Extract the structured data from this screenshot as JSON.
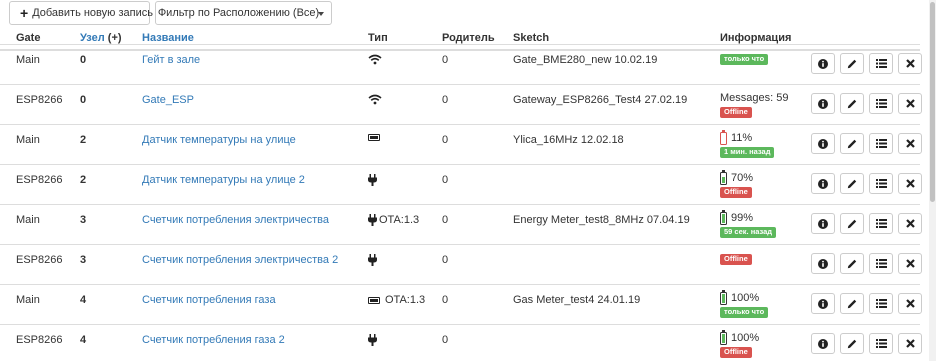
{
  "toolbar": {
    "add_label": "Добавить новую запись",
    "filter_label": "Фильтр по Расположению (Все)"
  },
  "columns": {
    "gate": "Gate",
    "node": "Узел",
    "node_sort": "(+)",
    "name": "Название",
    "type": "Тип",
    "parent": "Родитель",
    "sketch": "Sketch",
    "info": "Информация"
  },
  "colors": {
    "link": "#337ab7",
    "label_green": "#5cb85c",
    "label_red": "#d9534f"
  },
  "rows": [
    {
      "gate": "Main",
      "node": "0",
      "name": "Гейт в зале",
      "type_icon": "wifi-icon",
      "type_text": "",
      "parent": "0",
      "sketch": "Gate_BME280_new  10.02.19",
      "info_text": "",
      "battery": null,
      "status": "только что",
      "status_color": "green"
    },
    {
      "gate": "ESP8266",
      "node": "0",
      "name": "Gate_ESP",
      "type_icon": "wifi-icon",
      "type_text": "",
      "parent": "0",
      "sketch": "Gateway_ESP8266_Test4  27.02.19",
      "info_text": "Messages: 59",
      "battery": null,
      "status": "Offline",
      "status_color": "red"
    },
    {
      "gate": "Main",
      "node": "2",
      "name": "Датчик температуры на улице",
      "type_icon": "battery-icon",
      "type_text": "",
      "parent": "0",
      "sketch": "Ylica_16MHz  12.02.18",
      "info_text": "",
      "battery": "11%",
      "battery_level": 0.11,
      "status": "1 мин. назад",
      "status_color": "green"
    },
    {
      "gate": "ESP8266",
      "node": "2",
      "name": "Датчик температуры на улице 2",
      "type_icon": "plug-icon",
      "type_text": "",
      "parent": "0",
      "sketch": "",
      "info_text": "",
      "battery": "70%",
      "battery_level": 0.7,
      "status": "Offline",
      "status_color": "red"
    },
    {
      "gate": "Main",
      "node": "3",
      "name": "Счетчик потребления электричества",
      "type_icon": "plug-icon",
      "type_text": "OTA:1.3",
      "parent": "0",
      "sketch": "Energy Meter_test8_8MHz  07.04.19",
      "info_text": "",
      "battery": "99%",
      "battery_level": 0.99,
      "status": "59 сек. назад",
      "status_color": "green"
    },
    {
      "gate": "ESP8266",
      "node": "3",
      "name": "Счетчик потребления электричества 2",
      "type_icon": "plug-icon",
      "type_text": "",
      "parent": "0",
      "sketch": "",
      "info_text": "",
      "battery": null,
      "status": "Offline",
      "status_color": "red"
    },
    {
      "gate": "Main",
      "node": "4",
      "name": "Счетчик потребления газа",
      "type_icon": "battery-icon",
      "type_text": "OTA:1.3",
      "parent": "0",
      "sketch": "Gas Meter_test4  24.01.19",
      "info_text": "",
      "battery": "100%",
      "battery_level": 1.0,
      "status": "только что",
      "status_color": "green"
    },
    {
      "gate": "ESP8266",
      "node": "4",
      "name": "Счетчик потребления газа 2",
      "type_icon": "plug-icon",
      "type_text": "",
      "parent": "0",
      "sketch": "",
      "info_text": "",
      "battery": "100%",
      "battery_level": 1.0,
      "status": "Offline",
      "status_color": "red"
    }
  ],
  "actions": [
    "info-icon",
    "pencil-icon",
    "list-icon",
    "close-icon"
  ]
}
